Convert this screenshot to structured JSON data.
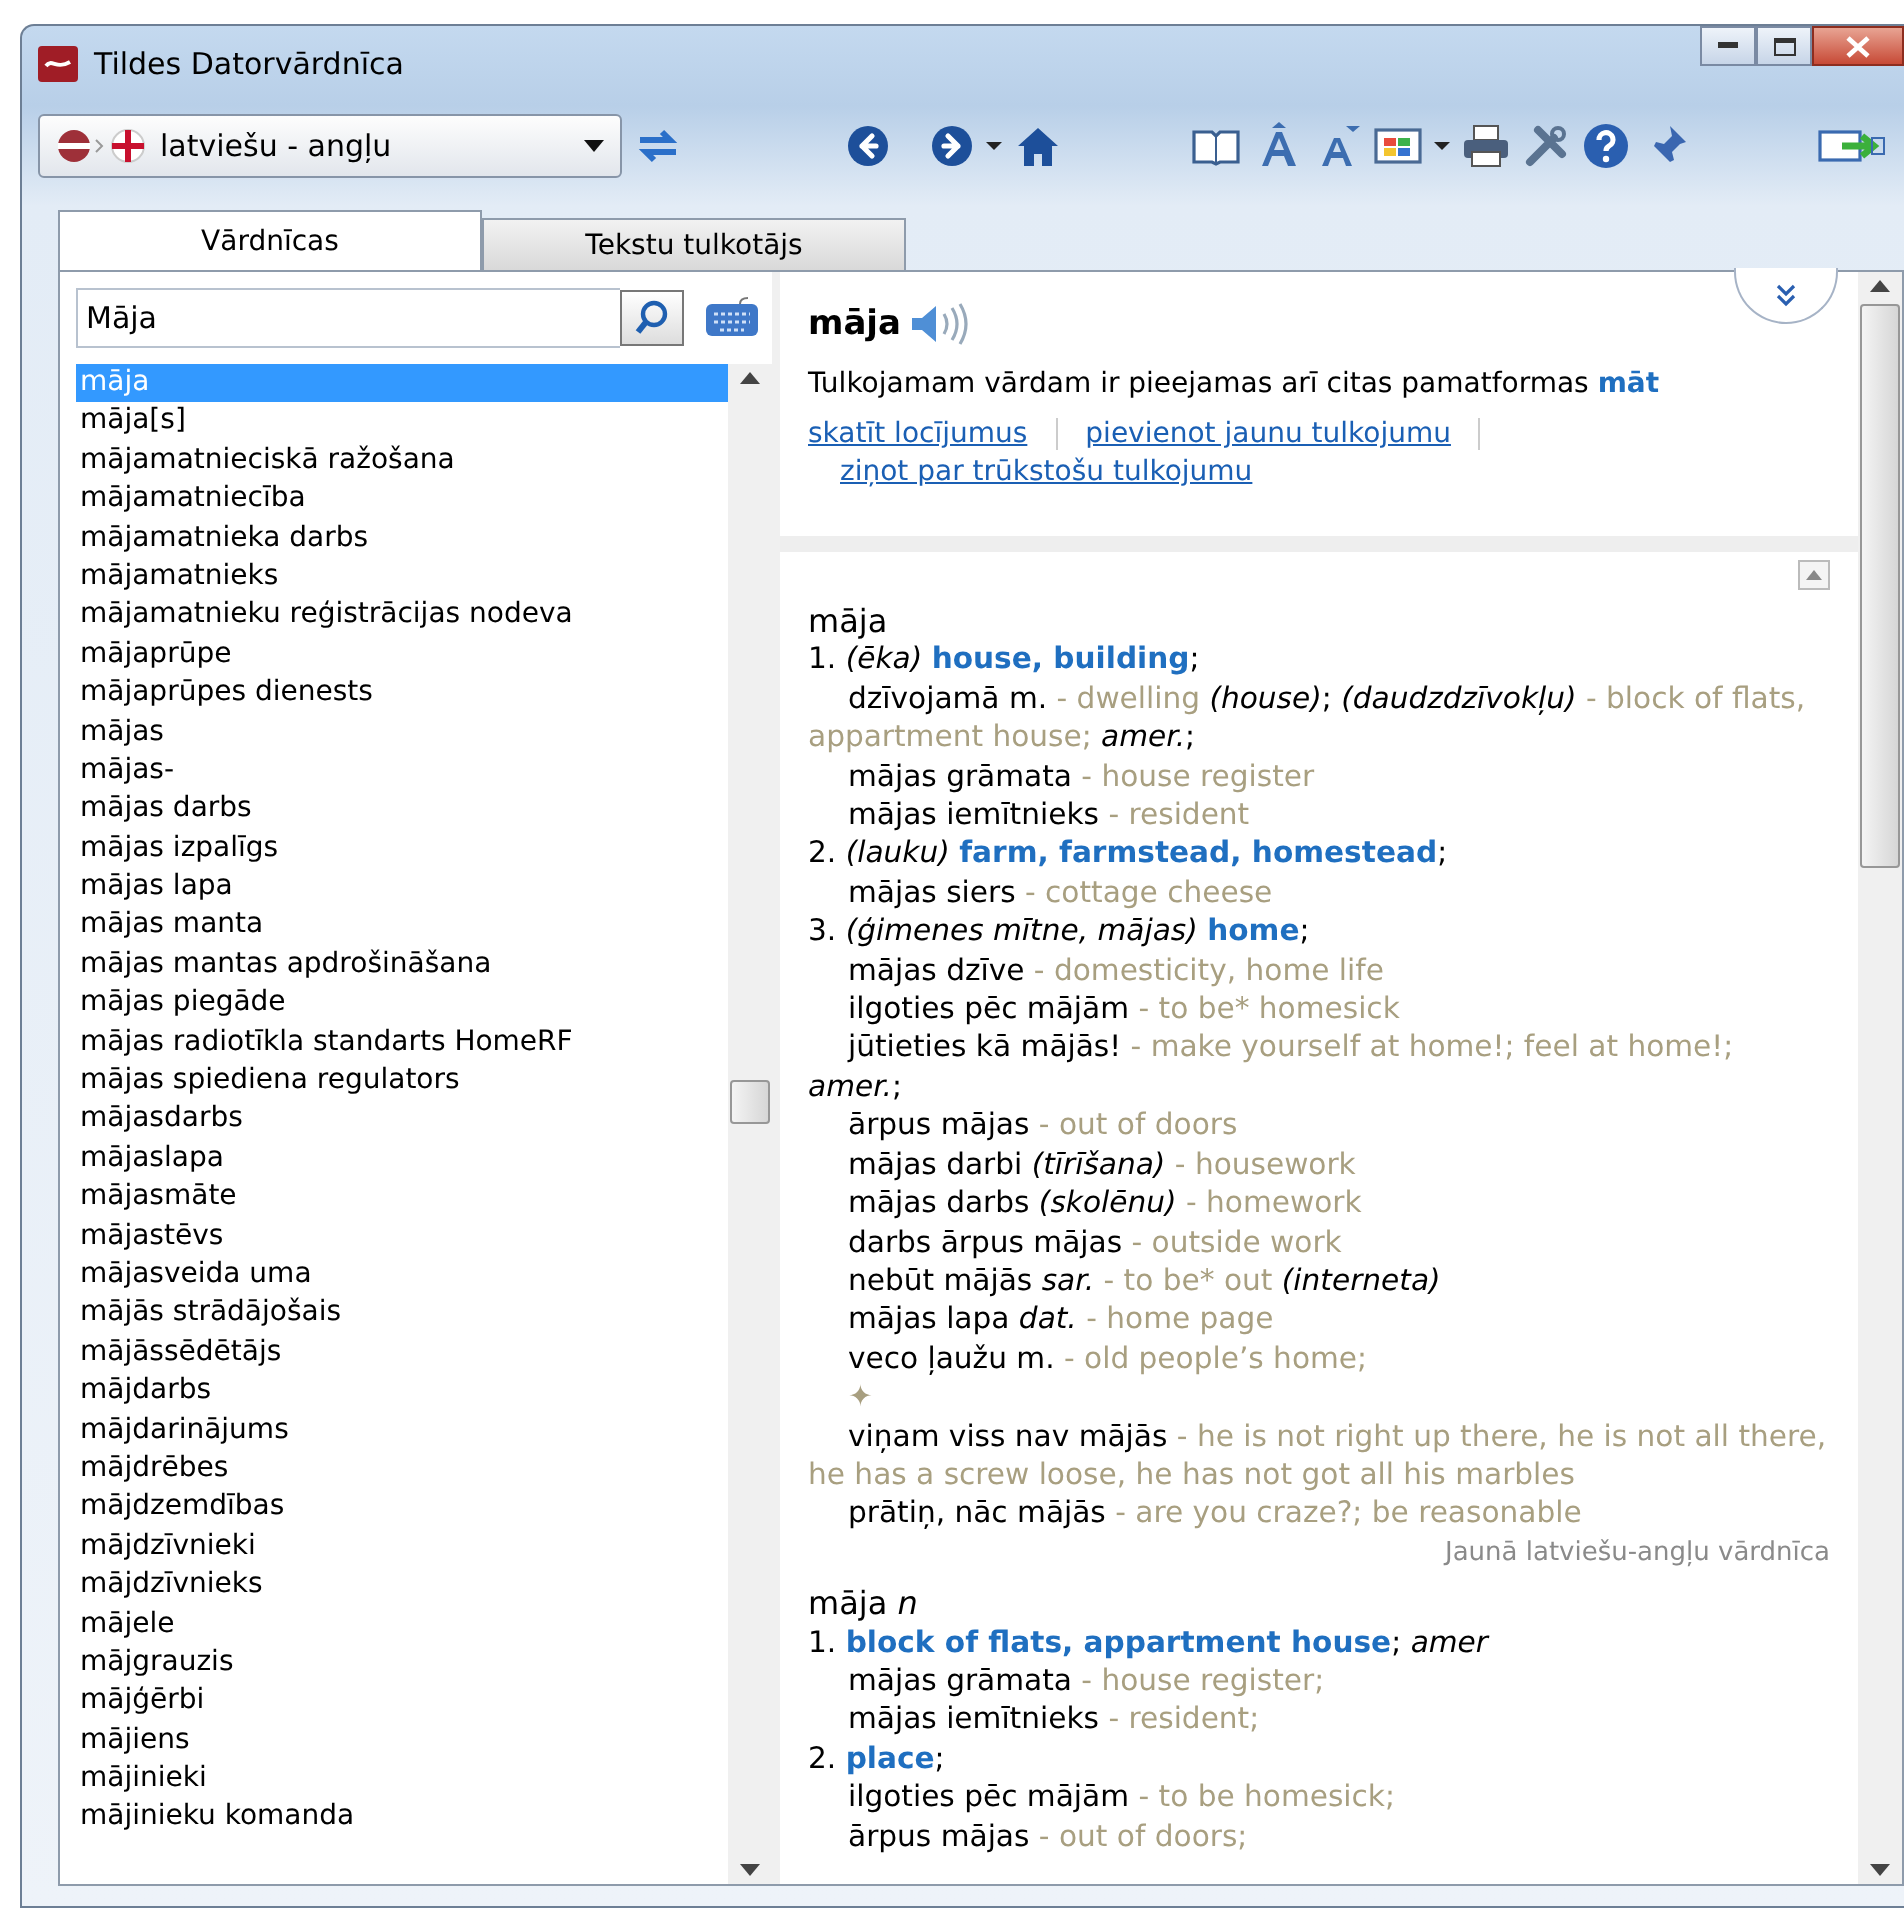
{
  "window": {
    "title": "Tildes Datorvārdnīca"
  },
  "toolbar": {
    "language_pair": "latviešu - angļu"
  },
  "tabs": [
    {
      "label": "Vārdnīcas",
      "selected": true
    },
    {
      "label": "Tekstu tulkotājs",
      "selected": false
    }
  ],
  "search": {
    "value": "Māja"
  },
  "word_list": {
    "items": [
      {
        "text": "māja",
        "selected": true
      },
      {
        "text": "māja[s]",
        "selected": false
      },
      {
        "text": "mājamatnieciskā ražošana",
        "selected": false
      },
      {
        "text": "mājamatniecība",
        "selected": false
      },
      {
        "text": "mājamatnieka darbs",
        "selected": false
      },
      {
        "text": "mājamatnieks",
        "selected": false
      },
      {
        "text": "mājamatnieku reģistrācijas nodeva",
        "selected": false
      },
      {
        "text": "mājaprūpe",
        "selected": false
      },
      {
        "text": "mājaprūpes dienests",
        "selected": false
      },
      {
        "text": "mājas",
        "selected": false
      },
      {
        "text": "mājas-",
        "selected": false
      },
      {
        "text": "mājas darbs",
        "selected": false
      },
      {
        "text": "mājas izpalīgs",
        "selected": false
      },
      {
        "text": "mājas lapa",
        "selected": false
      },
      {
        "text": "mājas manta",
        "selected": false
      },
      {
        "text": "mājas mantas apdrošināšana",
        "selected": false
      },
      {
        "text": "mājas piegāde",
        "selected": false
      },
      {
        "text": "mājas radiotīkla standarts HomeRF",
        "selected": false
      },
      {
        "text": "mājas spiediena regulators",
        "selected": false
      },
      {
        "text": "mājasdarbs",
        "selected": false
      },
      {
        "text": "mājaslapa",
        "selected": false
      },
      {
        "text": "mājasmāte",
        "selected": false
      },
      {
        "text": "mājastēvs",
        "selected": false
      },
      {
        "text": "mājasveida uma",
        "selected": false
      },
      {
        "text": "mājās strādājošais",
        "selected": false
      },
      {
        "text": "mājāssēdētājs",
        "selected": false
      },
      {
        "text": "mājdarbs",
        "selected": false
      },
      {
        "text": "mājdarinājums",
        "selected": false
      },
      {
        "text": "mājdrēbes",
        "selected": false
      },
      {
        "text": "mājdzemdības",
        "selected": false
      },
      {
        "text": "mājdzīvnieki",
        "selected": false
      },
      {
        "text": "mājdzīvnieks",
        "selected": false
      },
      {
        "text": "mājele",
        "selected": false
      },
      {
        "text": "mājgrauzis",
        "selected": false
      },
      {
        "text": "mājģērbi",
        "selected": false
      },
      {
        "text": "mājiens",
        "selected": false
      },
      {
        "text": "mājinieki",
        "selected": false
      },
      {
        "text": "mājinieku komanda",
        "selected": false
      }
    ]
  },
  "header": {
    "headword": "māja",
    "note": "Tulkojamam vārdam ir pieejamas arī citas pamatformas **māt**",
    "links": [
      "skatīt locījumus",
      "pievienot jaunu tulkojumu",
      "ziņot par trūkstošu tulkojumu"
    ]
  },
  "entries": [
    {
      "headword": "māja",
      "lines": [
        {
          "kind": "sense",
          "segments": [
            {
              "kind": "plain",
              "text": "1. "
            },
            {
              "kind": "italic",
              "text": "(ēka) "
            },
            {
              "kind": "term",
              "text": "house, building"
            },
            {
              "kind": "plain",
              "text": ";"
            }
          ]
        },
        {
          "kind": "phrase",
          "segments": [
            {
              "kind": "plain",
              "text": "dzīvojamā m."
            },
            {
              "kind": "trans",
              "text": " - dwelling "
            },
            {
              "kind": "italic",
              "text": "(house)"
            },
            {
              "kind": "plain",
              "text": "; "
            },
            {
              "kind": "italic",
              "text": "(daudzdzīvokļu)"
            },
            {
              "kind": "trans",
              "text": " - block of flats, appartment house; "
            },
            {
              "kind": "italic",
              "text": "amer."
            },
            {
              "kind": "plain",
              "text": ";"
            }
          ]
        },
        {
          "kind": "phrase",
          "segments": [
            {
              "kind": "plain",
              "text": "mājas grāmata"
            },
            {
              "kind": "trans",
              "text": " - house register"
            }
          ]
        },
        {
          "kind": "phrase",
          "segments": [
            {
              "kind": "plain",
              "text": "mājas iemītnieks"
            },
            {
              "kind": "trans",
              "text": " - resident"
            }
          ]
        },
        {
          "kind": "sense",
          "segments": [
            {
              "kind": "plain",
              "text": "2. "
            },
            {
              "kind": "italic",
              "text": "(lauku) "
            },
            {
              "kind": "term",
              "text": "farm, farmstead, homestead"
            },
            {
              "kind": "plain",
              "text": ";"
            }
          ]
        },
        {
          "kind": "phrase",
          "segments": [
            {
              "kind": "plain",
              "text": "mājas siers"
            },
            {
              "kind": "trans",
              "text": " - cottage cheese"
            }
          ]
        },
        {
          "kind": "sense",
          "segments": [
            {
              "kind": "plain",
              "text": "3. "
            },
            {
              "kind": "italic",
              "text": "(ģimenes mītne, mājas) "
            },
            {
              "kind": "term",
              "text": "home"
            },
            {
              "kind": "plain",
              "text": ";"
            }
          ]
        },
        {
          "kind": "phrase",
          "segments": [
            {
              "kind": "plain",
              "text": "mājas dzīve"
            },
            {
              "kind": "trans",
              "text": " - domesticity, home life"
            }
          ]
        },
        {
          "kind": "phrase",
          "segments": [
            {
              "kind": "plain",
              "text": "ilgoties pēc mājām"
            },
            {
              "kind": "trans",
              "text": " - to be* homesick"
            }
          ]
        },
        {
          "kind": "phrase",
          "segments": [
            {
              "kind": "plain",
              "text": "jūtieties kā mājās!"
            },
            {
              "kind": "trans",
              "text": " - make yourself at home!; feel at home!; "
            },
            {
              "kind": "italic",
              "text": "amer."
            },
            {
              "kind": "plain",
              "text": ";"
            }
          ]
        },
        {
          "kind": "phrase",
          "segments": [
            {
              "kind": "plain",
              "text": "ārpus mājas"
            },
            {
              "kind": "trans",
              "text": " - out of doors"
            }
          ]
        },
        {
          "kind": "phrase",
          "segments": [
            {
              "kind": "plain",
              "text": "mājas darbi "
            },
            {
              "kind": "italic",
              "text": "(tīrīšana)"
            },
            {
              "kind": "trans",
              "text": " - housework"
            }
          ]
        },
        {
          "kind": "phrase",
          "segments": [
            {
              "kind": "plain",
              "text": "mājas darbs "
            },
            {
              "kind": "italic",
              "text": "(skolēnu)"
            },
            {
              "kind": "trans",
              "text": " - homework"
            }
          ]
        },
        {
          "kind": "phrase",
          "segments": [
            {
              "kind": "plain",
              "text": "darbs ārpus mājas"
            },
            {
              "kind": "trans",
              "text": " - outside work"
            }
          ]
        },
        {
          "kind": "phrase",
          "segments": [
            {
              "kind": "plain",
              "text": "nebūt mājās "
            },
            {
              "kind": "italic",
              "text": "sar."
            },
            {
              "kind": "trans",
              "text": " - to be* out "
            },
            {
              "kind": "italic",
              "text": "(interneta)"
            }
          ]
        },
        {
          "kind": "phrase",
          "segments": [
            {
              "kind": "plain",
              "text": "mājas lapa "
            },
            {
              "kind": "italic",
              "text": "dat."
            },
            {
              "kind": "trans",
              "text": " - home page"
            }
          ]
        },
        {
          "kind": "phrase",
          "segments": [
            {
              "kind": "plain",
              "text": "veco ļaužu m."
            },
            {
              "kind": "trans",
              "text": " - old people’s home;"
            }
          ]
        },
        {
          "kind": "ornament",
          "segments": [
            {
              "kind": "trans",
              "text": "✦"
            }
          ]
        },
        {
          "kind": "phrase",
          "segments": [
            {
              "kind": "plain",
              "text": "viņam viss nav mājās"
            },
            {
              "kind": "trans",
              "text": " - he is not right up there, he is not all there, he has a screw loose, he has not got all his marbles"
            }
          ]
        },
        {
          "kind": "phrase",
          "segments": [
            {
              "kind": "plain",
              "text": "prātiņ, nāc mājās"
            },
            {
              "kind": "trans",
              "text": " - are you craze?; be reasonable"
            }
          ]
        }
      ],
      "source": "Jaunā latviešu-angļu vārdnīca"
    },
    {
      "headword": "māja",
      "pos": "n",
      "lines": [
        {
          "kind": "sense",
          "segments": [
            {
              "kind": "plain",
              "text": "1. "
            },
            {
              "kind": "term",
              "text": "block of flats, appartment house"
            },
            {
              "kind": "plain",
              "text": "; "
            },
            {
              "kind": "italic",
              "text": "amer"
            }
          ]
        },
        {
          "kind": "phrase",
          "segments": [
            {
              "kind": "plain",
              "text": "mājas grāmata"
            },
            {
              "kind": "trans",
              "text": " - house register;"
            }
          ]
        },
        {
          "kind": "phrase",
          "segments": [
            {
              "kind": "plain",
              "text": "mājas iemītnieks"
            },
            {
              "kind": "trans",
              "text": " - resident;"
            }
          ]
        },
        {
          "kind": "sense",
          "segments": [
            {
              "kind": "plain",
              "text": "2. "
            },
            {
              "kind": "term",
              "text": "place"
            },
            {
              "kind": "plain",
              "text": ";"
            }
          ]
        },
        {
          "kind": "phrase",
          "segments": [
            {
              "kind": "plain",
              "text": "ilgoties pēc mājām"
            },
            {
              "kind": "trans",
              "text": " - to be homesick;"
            }
          ]
        },
        {
          "kind": "phrase",
          "segments": [
            {
              "kind": "plain",
              "text": "ārpus mājas"
            },
            {
              "kind": "trans",
              "text": " - out of doors;"
            }
          ]
        }
      ]
    }
  ]
}
